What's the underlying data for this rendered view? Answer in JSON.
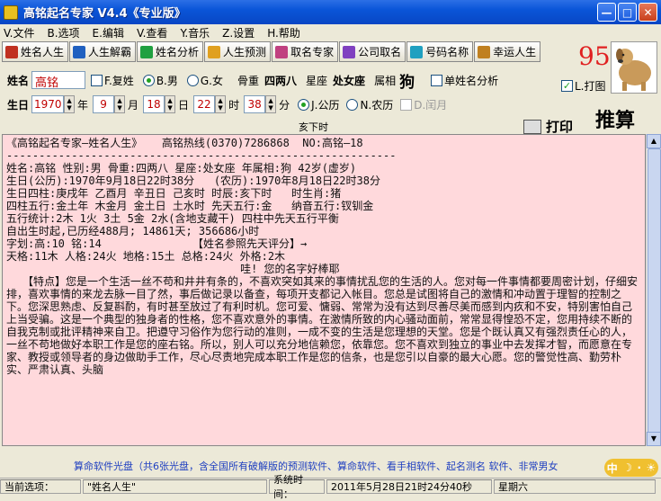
{
  "window": {
    "title": "高铭起名专家  V4.4《专业版》"
  },
  "menu": [
    "V.文件",
    "B.选项",
    "E.编辑",
    "V.查看",
    "Y.音乐",
    "Z.设置",
    "H.帮助"
  ],
  "toolbar": [
    {
      "label": "姓名人生",
      "color": "#c03020"
    },
    {
      "label": "人生解霸",
      "color": "#2060c0"
    },
    {
      "label": "姓名分析",
      "color": "#20a040"
    },
    {
      "label": "人生预测",
      "color": "#e0a020"
    },
    {
      "label": "取名专家",
      "color": "#c04080"
    },
    {
      "label": "公司取名",
      "color": "#8040c0"
    },
    {
      "label": "号码名称",
      "color": "#20a0c0"
    },
    {
      "label": "幸运人生",
      "color": "#c08020"
    }
  ],
  "score": "95",
  "form": {
    "name_label": "姓名",
    "name_value": "高铭",
    "fuxing_label": "F.复姓",
    "male_label": "B.男",
    "female_label": "G.女",
    "bone_label": "骨重",
    "bone_value": "四两八",
    "star_label": "星座",
    "star_value": "处女座",
    "sign_label": "属相",
    "sign_value": "狗",
    "single_label": "单姓名分析",
    "print_label": "L.打图",
    "birth_label": "生日",
    "year": "1970",
    "month": "9",
    "day": "18",
    "hour": "22",
    "minute": "38",
    "year_unit": "年",
    "month_unit": "月",
    "day_unit": "日",
    "hour_unit": "时",
    "minute_unit": "分",
    "solar_label": "J.公历",
    "lunar_label": "N.农历",
    "leap_label": "D.闰月",
    "hour_name": "亥下时",
    "print_btn": "打印",
    "calc_btn": "推算"
  },
  "content": {
    "lines": [
      "《高铭起名专家—姓名人生》   高铭热线(0370)7286868  NO:高铭—18",
      "------------------------------------------------------------",
      "姓名:高铭 性别:男 骨重:四两八 星座:处女座 年属相:狗 42岁(虚岁)",
      "生日(公历):1970年9月18日22时38分   (农历):1970年8月18日22时38分",
      "生日四柱:庚戌年 乙酉月 辛丑日 己亥时 时辰:亥下时   时生肖:猪",
      "四柱五行:金土年 木金月 金土日 土水时 先天五行:金   纳音五行:钗钏金",
      "五行统计:2木 1火 3土 5金 2水(含地支藏干) 四柱中先天五行平衡",
      "自出生时起,已历经488月; 14861天; 356686小时",
      "",
      "字划:高:10 铭:14              【姓名参照先天评分】→",
      "",
      "天格:11木 人格:24火 地格:15土 总格:24火 外格:2木",
      "                                    哇! 您的名字好棒耶"
    ],
    "paragraph": "　　【特点】您是一个生活一丝不苟和井井有条的，不喜欢突如其来的事情扰乱您的生活的人。您对每一件事情都要周密计划，仔细安排，喜欢事情的来龙去脉一目了然，事后做记录以备查，每项开支都记入帐目。您总是试图将自己的激情和冲动置于理智的控制之下。您深思熟虑、反复斟酌，有时甚至放过了有利时机。您可爱、慵弱、常常为没有达到尽善尽美而感到内疚和不安，特别害怕自己上当受骗。这是一个典型的独身者的性格，您不喜欢意外的事情。在激情所致的内心骚动面前，常常显得惶恐不定，您用持续不断的自我克制或批评精神来自卫。把遵守习俗作为您行动的准则，一成不变的生活是您理想的天堂。您是个既认真又有强烈责任心的人，一丝不苟地做好本职工作是您的座右铭。所以，别人可以充分地信赖您，依靠您。您不喜欢到独立的事业中去发挥才智，而愿意在专家、教授或领导者的身边做助手工作，尽心尽责地完成本职工作是您的信条，也是您引以自豪的最大心愿。您的警觉性高、勤劳朴实、严肃认真、头脑"
  },
  "ticker": "算命软件光盘（共6张光盘，含全国所有破解版的预测软件、算命软件、看手相软件、起名测名 软件、非常男女",
  "ime": {
    "a": "中",
    "b": "☽",
    "c": "·",
    "d": "☀"
  },
  "status": {
    "current_label": "当前选项：",
    "current_value": "\"姓名人生\"",
    "time_label": "系统时间：",
    "time_value": "2011年5月28日21时24分40秒",
    "weekday": "星期六"
  }
}
